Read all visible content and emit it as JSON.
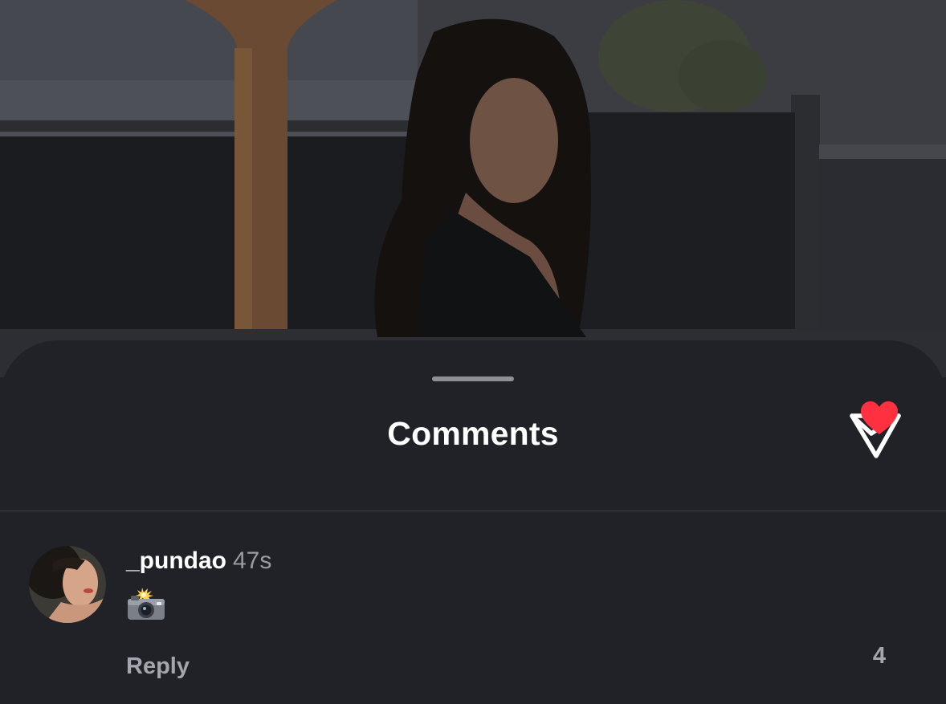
{
  "sheet": {
    "title": "Comments"
  },
  "icons": {
    "share": "paper-plane-icon",
    "like": "heart-icon",
    "comment_emoji": "camera-flash-emoji"
  },
  "comment": {
    "username": "_pundao",
    "time": "47s",
    "reply_label": "Reply",
    "like_count": "4",
    "liked": true
  },
  "colors": {
    "sheet_bg": "#212227",
    "like_red": "#ff3040",
    "text_primary": "#ffffff",
    "text_secondary": "#9a9ca3"
  }
}
